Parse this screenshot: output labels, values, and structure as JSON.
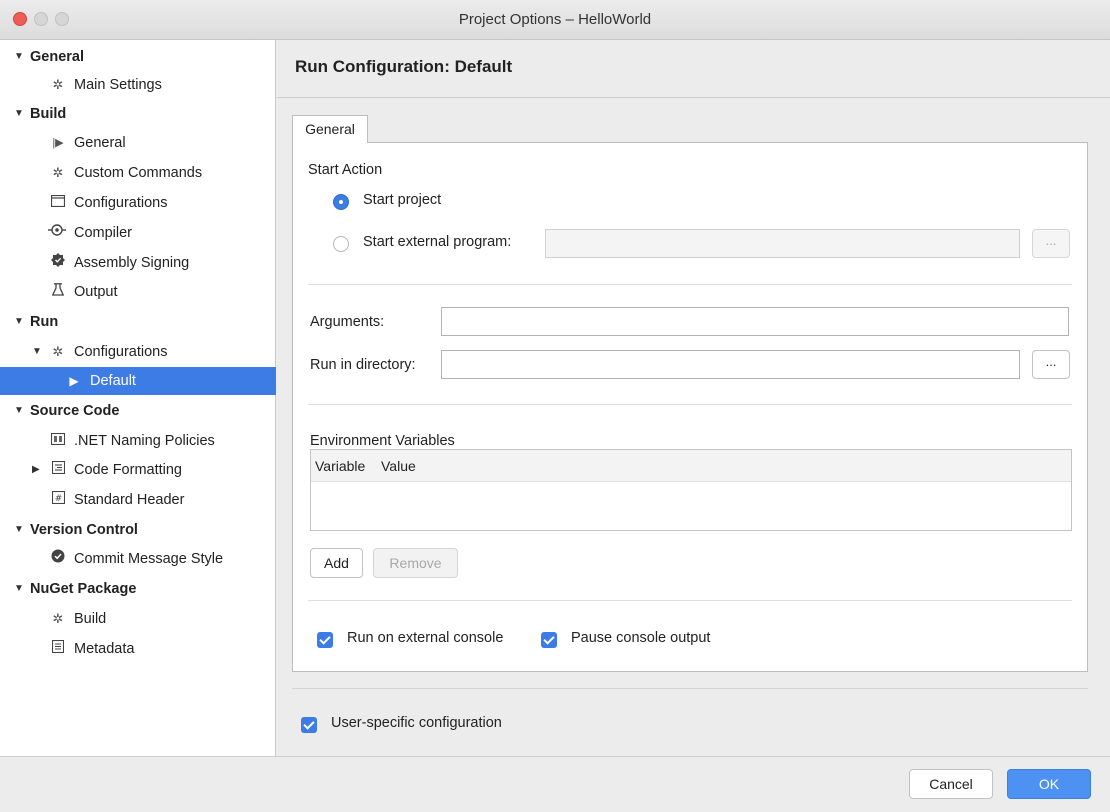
{
  "window": {
    "title": "Project Options – HelloWorld"
  },
  "sidebar": {
    "items": [
      {
        "label": "General",
        "kind": "category",
        "icon": ""
      },
      {
        "label": "Main Settings",
        "kind": "item",
        "icon": "gear-icon"
      },
      {
        "label": "Build",
        "kind": "category",
        "icon": ""
      },
      {
        "label": "General",
        "kind": "item",
        "icon": "play-bar-icon"
      },
      {
        "label": "Custom Commands",
        "kind": "item",
        "icon": "gear-icon"
      },
      {
        "label": "Configurations",
        "kind": "item",
        "icon": "window-icon"
      },
      {
        "label": "Compiler",
        "kind": "item",
        "icon": "compiler-icon"
      },
      {
        "label": "Assembly Signing",
        "kind": "item",
        "icon": "seal-icon"
      },
      {
        "label": "Output",
        "kind": "item",
        "icon": "flask-icon"
      },
      {
        "label": "Run",
        "kind": "category",
        "icon": ""
      },
      {
        "label": "Configurations",
        "kind": "item",
        "icon": "gear-icon"
      },
      {
        "label": "Default",
        "kind": "item",
        "icon": "play-icon",
        "selected": true
      },
      {
        "label": "Source Code",
        "kind": "category",
        "icon": ""
      },
      {
        "label": ".NET Naming Policies",
        "kind": "item",
        "icon": "naming-icon"
      },
      {
        "label": "Code Formatting",
        "kind": "item",
        "icon": "format-icon"
      },
      {
        "label": "Standard Header",
        "kind": "item",
        "icon": "hash-icon"
      },
      {
        "label": "Version Control",
        "kind": "category",
        "icon": ""
      },
      {
        "label": "Commit Message Style",
        "kind": "item",
        "icon": "commit-icon"
      },
      {
        "label": "NuGet Package",
        "kind": "category",
        "icon": ""
      },
      {
        "label": "Build",
        "kind": "item",
        "icon": "gear-icon"
      },
      {
        "label": "Metadata",
        "kind": "item",
        "icon": "document-icon"
      }
    ]
  },
  "main": {
    "title": "Run Configuration: Default",
    "tab": "General",
    "start_action": {
      "heading": "Start Action",
      "option_project": "Start project",
      "option_external": "Start external program:",
      "selected": "Start project",
      "external_program_value": ""
    },
    "arguments": {
      "label": "Arguments:",
      "value": ""
    },
    "run_directory": {
      "label": "Run in directory:",
      "value": ""
    },
    "browse_label": "...",
    "env": {
      "heading": "Environment Variables",
      "columns": [
        "Variable",
        "Value"
      ],
      "rows": [],
      "add_label": "Add",
      "remove_label": "Remove"
    },
    "run_on_external_console": {
      "label": "Run on external console",
      "checked": true
    },
    "pause_console_output": {
      "label": "Pause console output",
      "checked": true
    },
    "user_specific": {
      "label": "User-specific configuration",
      "checked": true
    }
  },
  "footer": {
    "cancel_label": "Cancel",
    "ok_label": "OK"
  },
  "colors": {
    "accent": "#3d7be5",
    "ok_button": "#4d92f3",
    "close": "#ee5d58"
  }
}
